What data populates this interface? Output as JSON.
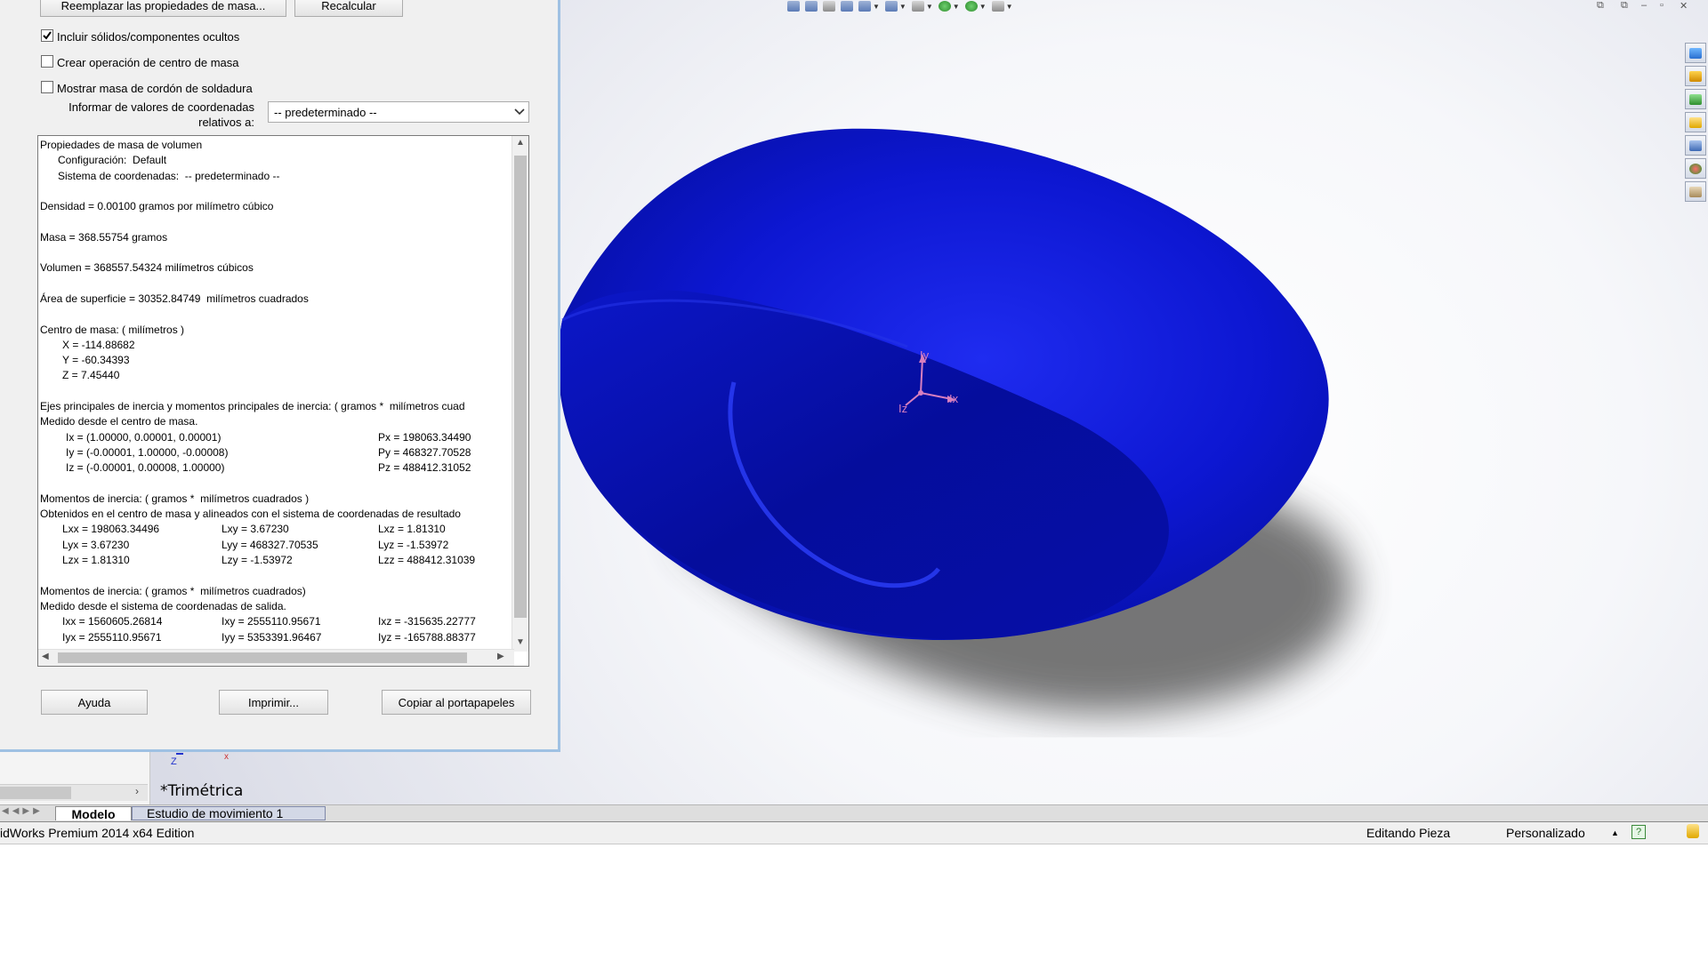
{
  "dialog": {
    "replace_button": "Reemplazar las propiedades de masa...",
    "recalc_button": "Recalcular",
    "include_hidden": {
      "label": "Incluir sólidos/componentes ocultos",
      "checked": true
    },
    "create_com": {
      "label": "Crear operación de centro de masa",
      "checked": false
    },
    "weld_mass": {
      "label": "Mostrar masa de cordón de soldadura",
      "checked": false
    },
    "report_label_1": "Informar de valores de coordenadas",
    "report_label_2": "relativos a:",
    "coord_select": "-- predeterminado --",
    "results": {
      "title": "Propiedades de masa de volumen",
      "config": "Configuración:  Default",
      "coords": "Sistema de coordenadas:  -- predeterminado --",
      "density": "Densidad = 0.00100 gramos por milímetro cúbico",
      "mass": "Masa = 368.55754 gramos",
      "volume": "Volumen = 368557.54324 milímetros cúbicos",
      "area": "Área de superficie = 30352.84749  milímetros cuadrados",
      "com_header": "Centro de masa: ( milímetros )",
      "com_x": "X = -114.88682",
      "com_y": "Y = -60.34393",
      "com_z": "Z = 7.45440",
      "axes_header": "Ejes principales de inercia y momentos principales de inercia: ( gramos *  milímetros cuad",
      "axes_sub": "Medido desde el centro de masa.",
      "ix": "Ix = (1.00000, 0.00001, 0.00001)",
      "px": "Px = 198063.34490",
      "iy": "Iy = (-0.00001, 1.00000, -0.00008)",
      "py": "Py = 468327.70528",
      "iz": "Iz = (-0.00001, 0.00008, 1.00000)",
      "pz": "Pz = 488412.31052",
      "moi1_header": "Momentos de inercia: ( gramos *  milímetros cuadrados )",
      "moi1_sub": "Obtenidos en el centro de masa y alineados con el sistema de coordenadas de resultado",
      "lxx": "Lxx = 198063.34496",
      "lxy": "Lxy = 3.67230",
      "lxz": "Lxz = 1.81310",
      "lyx": "Lyx = 3.67230",
      "lyy": "Lyy = 468327.70535",
      "lyz": "Lyz = -1.53972",
      "lzx": "Lzx = 1.81310",
      "lzy": "Lzy = -1.53972",
      "lzz": "Lzz = 488412.31039",
      "moi2_header": "Momentos de inercia: ( gramos *  milímetros cuadrados)",
      "moi2_sub": "Medido desde el sistema de coordenadas de salida.",
      "ixx": "Ixx = 1560605.26814",
      "ixy": "Ixy = 2555110.95671",
      "ixz": "Ixz = -315635.22777",
      "iyx": "Iyx = 2555110.95671",
      "iyy": "Iyy = 5353391.96467",
      "iyz": "Iyz = -165788.88377"
    },
    "help_button": "Ayuda",
    "print_button": "Imprimir...",
    "copy_button": "Copiar al portapapeles"
  },
  "viewport": {
    "view_name": "*Trimétrica",
    "triad": {
      "x": "Ix",
      "y": "Iy",
      "z": "Iz"
    }
  },
  "tabs": {
    "model": "Modelo",
    "motion": "Estudio de movimiento 1"
  },
  "status": {
    "app": "idWorks Premium 2014 x64 Edition",
    "mode": "Editando Pieza",
    "units": "Personalizado"
  },
  "colors": {
    "part": "#0a14c8",
    "dialog_border": "#9fc1e3"
  },
  "icons": [
    "zoom-fit-icon",
    "zoom-area-icon",
    "previous-view-icon",
    "section-view-icon",
    "view-orientation-icon",
    "display-style-icon",
    "hide-show-icon",
    "appearance-icon",
    "scene-icon",
    "view-settings-icon"
  ]
}
